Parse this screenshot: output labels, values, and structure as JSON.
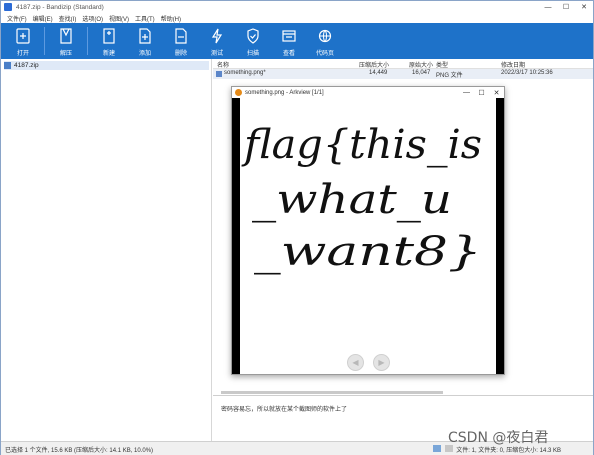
{
  "window": {
    "title": "4187.zip - Bandizip (Standard)"
  },
  "menu": [
    "文件(F)",
    "编辑(E)",
    "查找(I)",
    "选项(O)",
    "视图(V)",
    "工具(T)",
    "帮助(H)"
  ],
  "toolbar": [
    {
      "label": "打开",
      "icon": "open-icon"
    },
    {
      "label": "解压",
      "icon": "extract-icon"
    },
    {
      "label": "新建",
      "icon": "new-archive-icon"
    },
    {
      "label": "添加",
      "icon": "add-icon"
    },
    {
      "label": "删除",
      "icon": "delete-icon"
    },
    {
      "label": "测试",
      "icon": "test-icon"
    },
    {
      "label": "扫描",
      "icon": "scan-icon"
    },
    {
      "label": "查看",
      "icon": "view-icon"
    },
    {
      "label": "代码页",
      "icon": "codepage-icon"
    }
  ],
  "tree": {
    "root": "4187.zip"
  },
  "columns": [
    "名称",
    "压缩后大小",
    "原始大小",
    "类型",
    "修改日期"
  ],
  "files": [
    {
      "name": "something.png*",
      "packed": "14,449",
      "size": "16,047",
      "type": "PNG 文件",
      "modified": "2022/3/17 10:25:36"
    }
  ],
  "comment": "密码容易忘，所以就放在某个截图师的软件上了",
  "status": {
    "left": "已选择 1 个文件, 15.6 KB (压缩后大小: 14.1 KB, 10.0%)",
    "right": "文件: 1, 文件夹: 0, 压缩包大小: 14.3 KB"
  },
  "viewer": {
    "title": "something.png - Arkview [1/1]",
    "handwriting": [
      "flag{this_is",
      "_what_u",
      "_want8}"
    ]
  },
  "watermark": "CSDN @夜白君"
}
